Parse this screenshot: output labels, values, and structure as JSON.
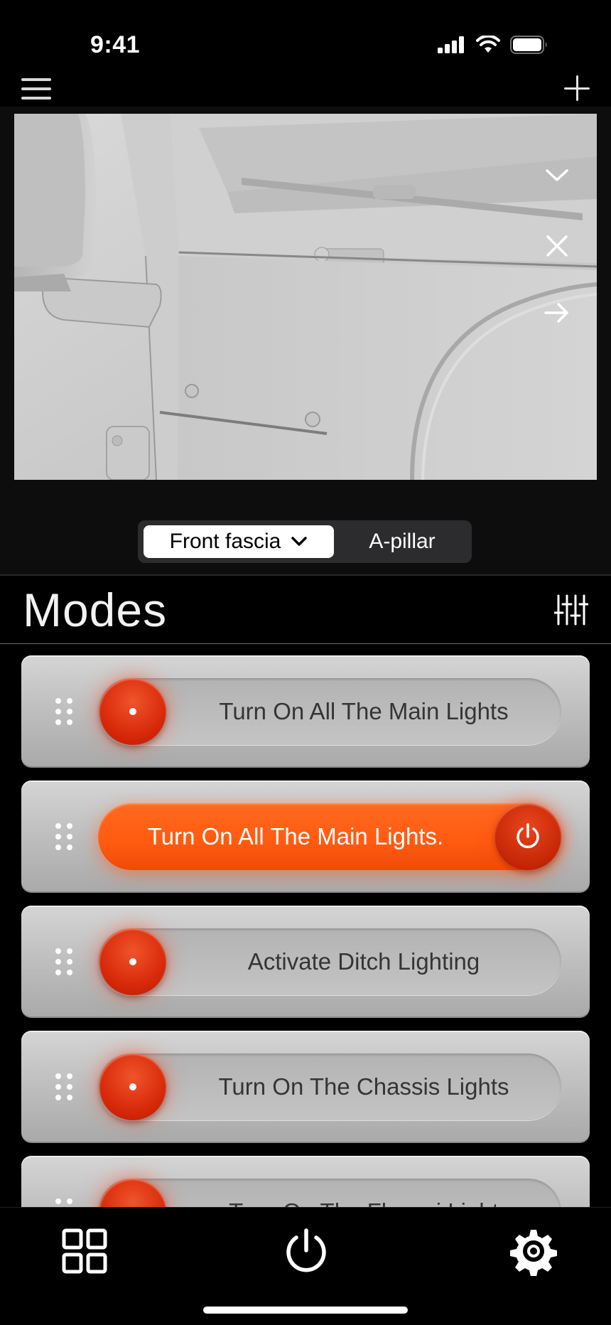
{
  "status_bar": {
    "time": "9:41"
  },
  "preview": {
    "location_tabs": [
      {
        "label": "Front fascia",
        "selected": true
      },
      {
        "label": "A-pillar",
        "selected": false
      }
    ]
  },
  "modes": {
    "title": "Modes",
    "items": [
      {
        "label": "Turn On All The Main Lights",
        "active": false
      },
      {
        "label": "Turn On All The Main Lights.",
        "active": true
      },
      {
        "label": "Activate Ditch Lighting",
        "active": false
      },
      {
        "label": "Turn On The Chassis Lights",
        "active": false
      },
      {
        "label": "Turn On The Fleasci Light",
        "active": false
      }
    ]
  },
  "colors": {
    "accent": "#FF5A10",
    "knob": "#D82A0A",
    "background": "#000000",
    "card": "#C0C0C0"
  },
  "icons": {
    "menu": "hamburger-icon",
    "add": "plus-icon",
    "collapse": "chevron-down-icon",
    "close": "close-icon",
    "next": "arrow-right-icon",
    "filter": "sliders-icon",
    "drag": "drag-handle-icon",
    "power": "power-icon",
    "grid": "grid-icon",
    "settings": "gear-icon"
  }
}
